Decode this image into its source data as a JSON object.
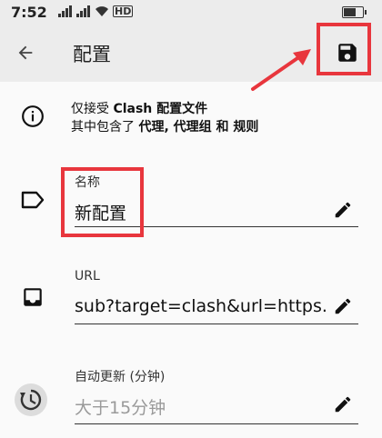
{
  "status_bar": {
    "time": "7:52",
    "network_badge": "HD"
  },
  "app_bar": {
    "back_icon": "arrow-left-icon",
    "title": "配置",
    "save_icon": "floppy-save-icon"
  },
  "info": {
    "icon": "info-circle-icon",
    "line1_prefix": "仅接受",
    "line1_strong": "Clash 配置文件",
    "line2_prefix": "其中包含了",
    "line2_strong": "代理, 代理组 和 规则"
  },
  "fields": {
    "name": {
      "icon": "label-tag-icon",
      "label": "名称",
      "value": "新配置"
    },
    "url": {
      "icon": "inbox-icon",
      "label": "URL",
      "value": "sub?target=clash&url=https..."
    },
    "auto_update": {
      "icon": "history-icon",
      "label": "自动更新 (分钟)",
      "placeholder": "大于15分钟"
    }
  },
  "colors": {
    "highlight": "#e8363d",
    "background": "#fafafa",
    "app_bar": "#ececec"
  }
}
